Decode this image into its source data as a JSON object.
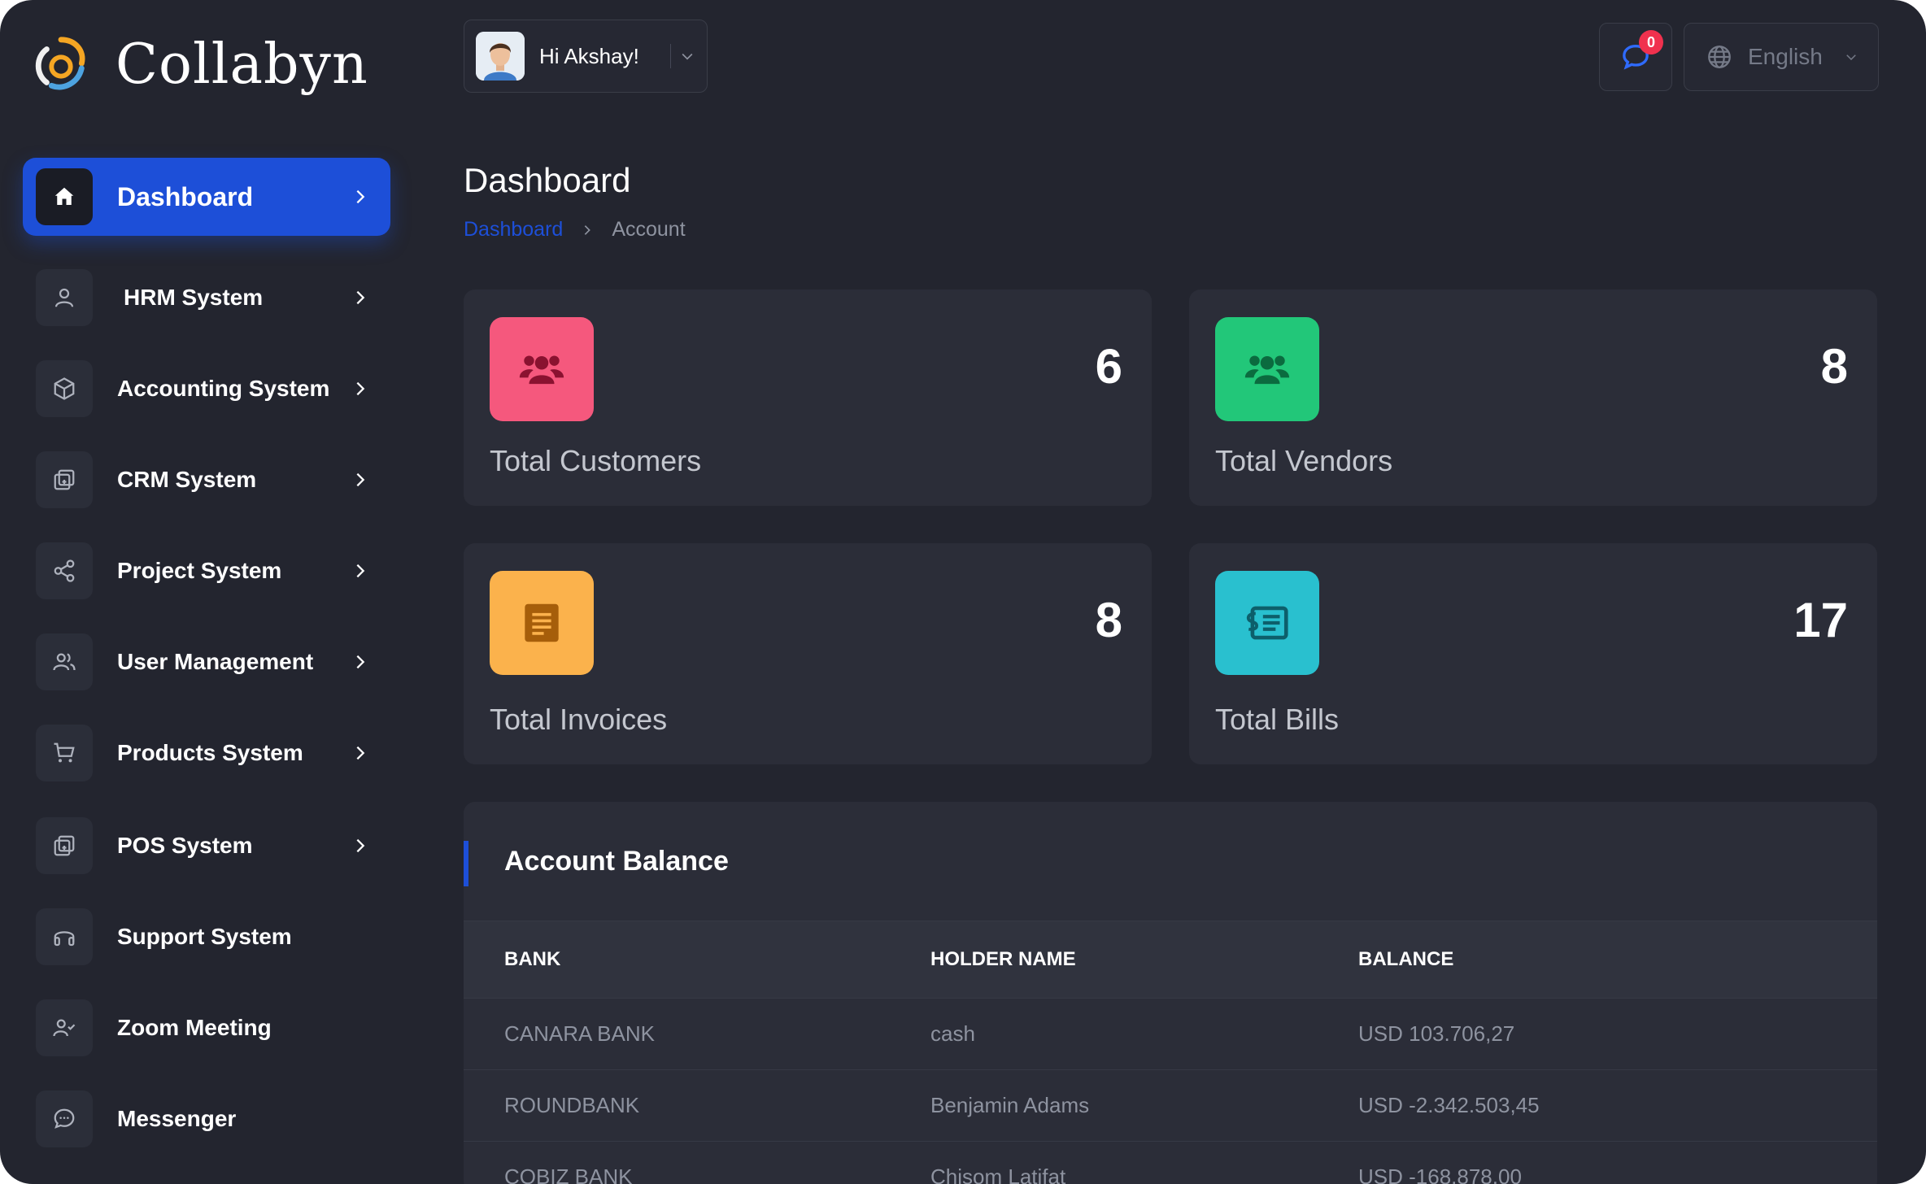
{
  "app": {
    "name": "Collabyn"
  },
  "header": {
    "greeting": "Hi Akshay!",
    "notification_count": "0",
    "language": "English"
  },
  "sidebar": {
    "items": [
      {
        "label": "Dashboard",
        "icon": "home-icon",
        "active": true
      },
      {
        "label": "HRM System",
        "icon": "user-icon"
      },
      {
        "label": "Accounting System",
        "icon": "box-icon"
      },
      {
        "label": "CRM System",
        "icon": "layers-icon"
      },
      {
        "label": "Project System",
        "icon": "share-icon"
      },
      {
        "label": "User Management",
        "icon": "users-icon"
      },
      {
        "label": "Products System",
        "icon": "cart-icon"
      },
      {
        "label": "POS System",
        "icon": "layers-icon"
      },
      {
        "label": "Support System",
        "icon": "headphones-icon"
      },
      {
        "label": "Zoom Meeting",
        "icon": "user-check-icon"
      },
      {
        "label": "Messenger",
        "icon": "message-icon"
      }
    ]
  },
  "page": {
    "title": "Dashboard",
    "breadcrumb": {
      "link": "Dashboard",
      "current": "Account"
    }
  },
  "stats": [
    {
      "label": "Total Customers",
      "value": "6",
      "color": "#f5587d",
      "icon": "customers-icon"
    },
    {
      "label": "Total Vendors",
      "value": "8",
      "color": "#22c779",
      "icon": "vendors-icon"
    },
    {
      "label": "Total Invoices",
      "value": "8",
      "color": "#fbb24c",
      "icon": "invoice-icon"
    },
    {
      "label": "Total Bills",
      "value": "17",
      "color": "#29c0cf",
      "icon": "bill-icon"
    }
  ],
  "account_balance": {
    "title": "Account Balance",
    "columns": [
      "BANK",
      "HOLDER NAME",
      "BALANCE"
    ],
    "rows": [
      [
        "CANARA BANK",
        "cash",
        "USD 103.706,27"
      ],
      [
        "ROUNDBANK",
        "Benjamin Adams",
        "USD -2.342.503,45"
      ],
      [
        "COBIZ BANK",
        "Chisom Latifat",
        "USD -168.878,00"
      ]
    ]
  },
  "colors": {
    "background": "#23252f",
    "card": "#2b2d38",
    "accent": "#1d4fd8"
  }
}
